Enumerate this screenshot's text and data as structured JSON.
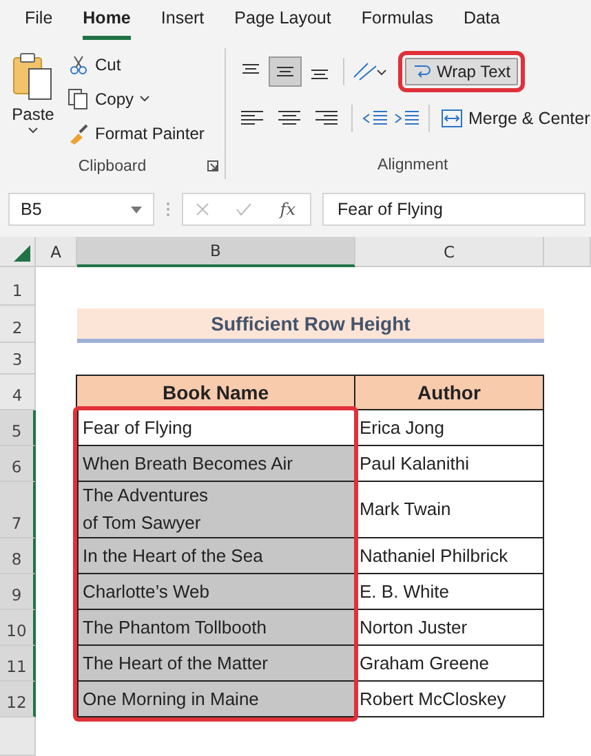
{
  "menu_tabs": [
    {
      "label": "File",
      "selected": false
    },
    {
      "label": "Home",
      "selected": true
    },
    {
      "label": "Insert",
      "selected": false
    },
    {
      "label": "Page Layout",
      "selected": false
    },
    {
      "label": "Formulas",
      "selected": false
    },
    {
      "label": "Data",
      "selected": false
    }
  ],
  "clipboard": {
    "paste": "Paste",
    "cut": "Cut",
    "copy": "Copy",
    "format_painter": "Format Painter",
    "label": "Clipboard"
  },
  "alignment": {
    "vertical": [
      {
        "selected": false
      },
      {
        "selected": true
      },
      {
        "selected": false
      }
    ],
    "wrap_text": {
      "label": "Wrap Text",
      "highlighted": true
    },
    "merge": "Merge & Center",
    "label": "Alignment"
  },
  "name_box": "B5",
  "function_label": "fx",
  "formula": "Fear of Flying",
  "columns": [
    {
      "label": "A",
      "selected": false
    },
    {
      "label": "B",
      "selected": true
    },
    {
      "label": "C",
      "selected": false
    }
  ],
  "row_headers": [
    {
      "label": "1",
      "selected": false
    },
    {
      "label": "2",
      "selected": false
    },
    {
      "label": "3",
      "selected": false
    },
    {
      "label": "4",
      "selected": false
    },
    {
      "label": "5",
      "selected": true
    },
    {
      "label": "6",
      "selected": true
    },
    {
      "label": "7",
      "selected": true
    },
    {
      "label": "8",
      "selected": true
    },
    {
      "label": "9",
      "selected": true
    },
    {
      "label": "10",
      "selected": true
    },
    {
      "label": "11",
      "selected": true
    },
    {
      "label": "12",
      "selected": true
    }
  ],
  "title": "Sufficient Row Height",
  "headers": [
    "Book Name",
    "Author"
  ],
  "records": [
    {
      "book": "Fear of Flying",
      "author": "Erica Jong",
      "active": true
    },
    {
      "book": "When Breath Becomes Air",
      "author": "Paul Kalanithi",
      "active": false
    },
    {
      "book": "The Adventures\nof Tom Sawyer",
      "author": "Mark Twain",
      "active": false
    },
    {
      "book": "In the Heart of the Sea",
      "author": "Nathaniel Philbrick",
      "active": false
    },
    {
      "book": "Charlotte’s Web",
      "author": "E. B. White",
      "active": false
    },
    {
      "book": "The Phantom Tollbooth",
      "author": "Norton Juster",
      "active": false
    },
    {
      "book": "The Heart of the Matter",
      "author": "Graham Greene",
      "active": false
    },
    {
      "book": "One Morning in Maine",
      "author": "Robert McCloskey",
      "active": false
    }
  ],
  "highlight_outline": true
}
